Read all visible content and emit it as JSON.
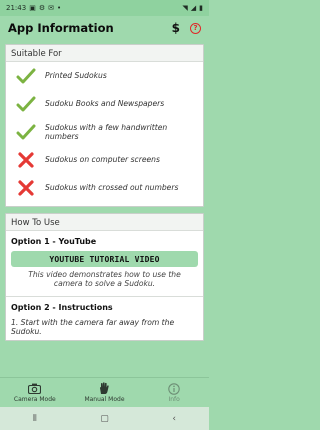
{
  "status_bar": {
    "time": "21:43"
  },
  "app_bar": {
    "title": "App Information",
    "dollar_label": "$",
    "help_label": "?"
  },
  "suitable": {
    "header": "Suitable For",
    "items": [
      {
        "icon": "check-icon",
        "text": "Printed Sudokus",
        "positive": true
      },
      {
        "icon": "check-icon",
        "text": "Sudoku Books and Newspapers",
        "positive": true
      },
      {
        "icon": "check-icon",
        "text": "Sudokus with a few handwritten numbers",
        "positive": true
      },
      {
        "icon": "cross-icon",
        "text": "Sudokus on computer screens",
        "positive": false
      },
      {
        "icon": "cross-icon",
        "text": "Sudokus with crossed out numbers",
        "positive": false
      }
    ]
  },
  "how_to": {
    "header": "How To Use",
    "option1_title": "Option 1 - YouTube",
    "youtube_button": "YOUTUBE TUTORIAL VIDEO",
    "option1_desc": "This video demonstrates how to use the camera to solve a Sudoku.",
    "option2_title": "Option 2 - Instructions",
    "step1": "1. Start with the camera far away from the Sudoku."
  },
  "bottom_nav": [
    {
      "label": "Camera Mode",
      "icon": "camera-icon",
      "active": false
    },
    {
      "label": "Manual Mode",
      "icon": "hand-icon",
      "active": false
    },
    {
      "label": "Info",
      "icon": "info-icon",
      "active": true
    }
  ],
  "colors": {
    "accent": "#9fd9ad",
    "check": "#7cb342",
    "cross": "#e53935",
    "help": "#e02828"
  }
}
